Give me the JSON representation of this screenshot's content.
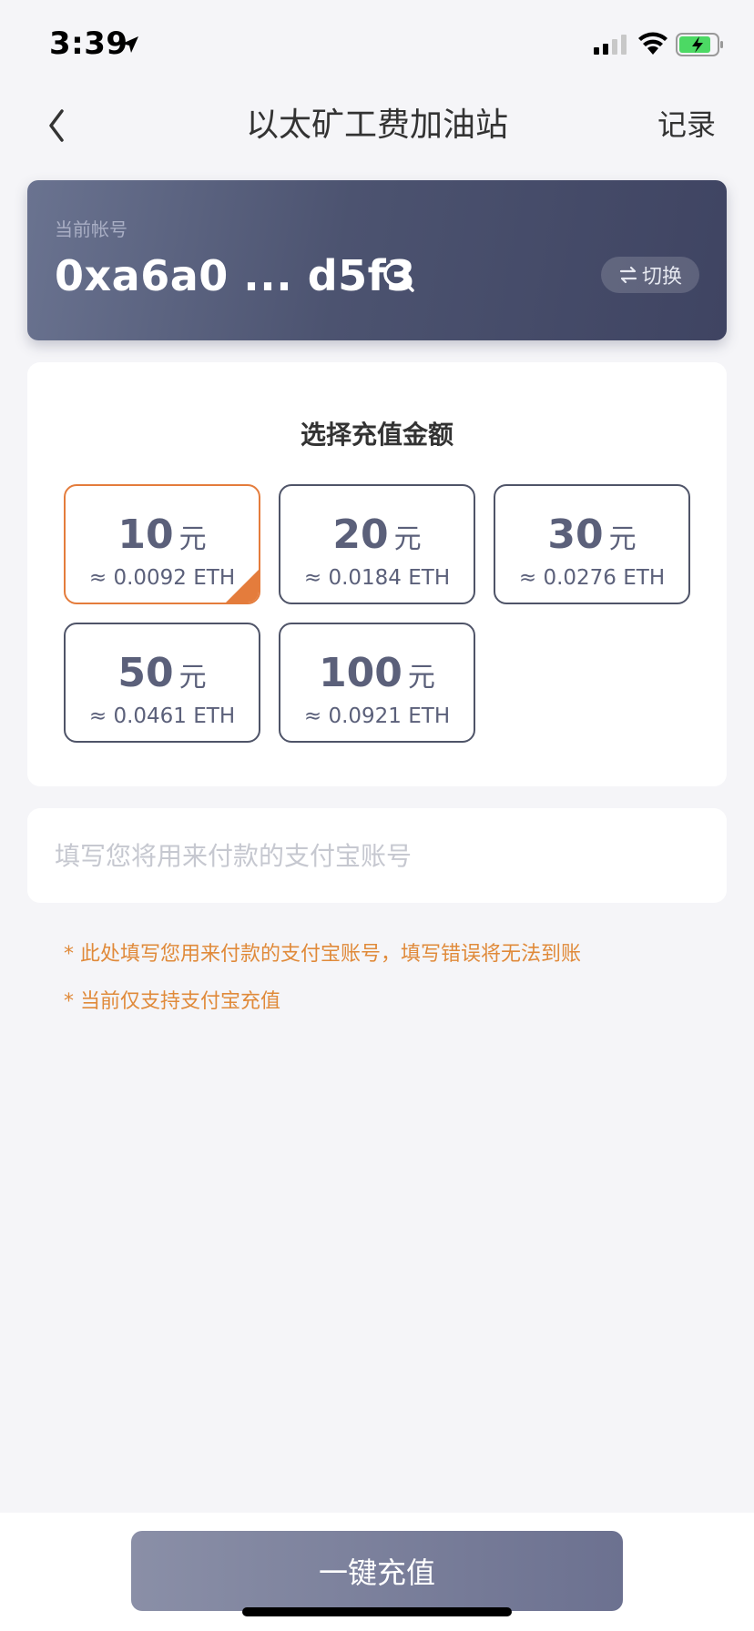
{
  "status_bar": {
    "time": "3:39"
  },
  "nav": {
    "title": "以太矿工费加油站",
    "right_label": "记录"
  },
  "account": {
    "label": "当前帐号",
    "address": "0xa6a0 ... d5f3",
    "switch_label": "切换"
  },
  "amount": {
    "title": "选择充值金额",
    "unit": "元",
    "options": [
      {
        "value": "10",
        "eth": "≈ 0.0092 ETH",
        "selected": true
      },
      {
        "value": "20",
        "eth": "≈ 0.0184 ETH",
        "selected": false
      },
      {
        "value": "30",
        "eth": "≈ 0.0276 ETH",
        "selected": false
      },
      {
        "value": "50",
        "eth": "≈ 0.0461 ETH",
        "selected": false
      },
      {
        "value": "100",
        "eth": "≈ 0.0921 ETH",
        "selected": false
      }
    ]
  },
  "alipay": {
    "placeholder": "填写您将用来付款的支付宝账号",
    "value": ""
  },
  "notes": [
    "* 此处填写您用来付款的支付宝账号，填写错误将无法到账",
    "* 当前仅支持支付宝充值"
  ],
  "recharge_button": {
    "label": "一键充值"
  },
  "colors": {
    "accent": "#e47c3c",
    "card_dark": "#4c5370",
    "option_border": "#4f5468",
    "note": "#e08a3a"
  }
}
